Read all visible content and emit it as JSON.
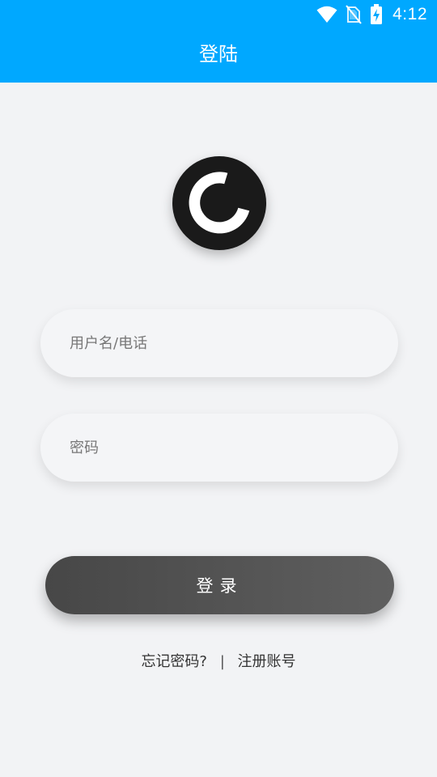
{
  "status_bar": {
    "time": "4:12",
    "icons": [
      "wifi-icon",
      "no-sim-icon",
      "battery-charging-icon"
    ]
  },
  "header": {
    "title": "登陆",
    "background": "#00a8ff"
  },
  "logo": {
    "icon": "app-logo-icon"
  },
  "form": {
    "username_placeholder": "用户名/电话",
    "username_value": "",
    "password_placeholder": "密码",
    "password_value": "",
    "login_label": "登录"
  },
  "links": {
    "forgot_password": "忘记密码?",
    "separator": "|",
    "register": "注册账号"
  },
  "colors": {
    "accent": "#00a8ff",
    "page_background": "#f2f3f5",
    "button_dark": "#474747"
  }
}
